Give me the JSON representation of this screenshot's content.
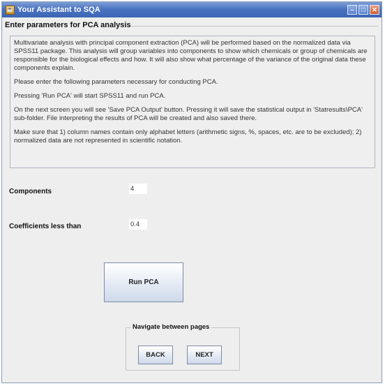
{
  "window": {
    "title": "Your Assistant to SQA",
    "app_icon": "java-coffee-icon",
    "controls": [
      "minimize",
      "maximize",
      "close"
    ]
  },
  "panel": {
    "title": "Enter parameters for PCA analysis"
  },
  "description": {
    "paragraphs": [
      "Multivariate analysis with principal component extraction (PCA) will be performed based on the normalized data via SPSS11 package. This analysis will group variables into components to show which chemicals or group of chemicals are responsible for the biological effects and how. It will also show what percentage of the variance of the original data these components explain.",
      "Please enter the following parameters necessary for conducting PCA.",
      "Pressing 'Run PCA' will start SPSS11 and run PCA.",
      "On the next screen you will see 'Save PCA Output' button. Pressing it will save the statistical output in 'Statresults\\PCA' sub-folder. File interpreting the results of PCA will be created and also saved there.",
      "Make sure that 1) column names contain only alphabet letters (arithmetic signs, %, spaces, etc. are to be excluded); 2) normalized data are not represented in scientific notation."
    ]
  },
  "params": {
    "components_label": "Components",
    "components_value": "4",
    "coefficients_label": "Coefficients less than",
    "coefficients_value": "0.4"
  },
  "actions": {
    "run_label": "Run PCA"
  },
  "navigation": {
    "title": "Navigate between pages",
    "back_label": "BACK",
    "next_label": "NEXT"
  }
}
